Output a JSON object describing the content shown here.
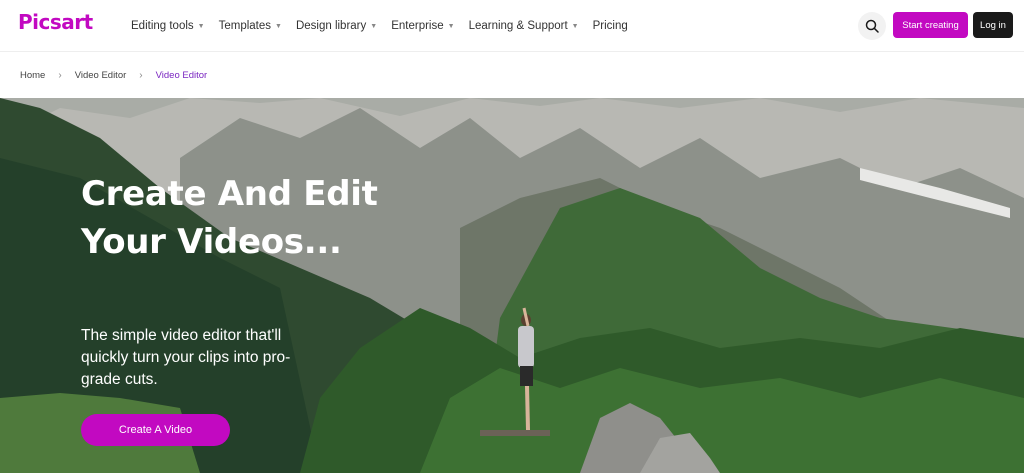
{
  "brand": {
    "logo_text": "Picsart",
    "accent": "#c209c1"
  },
  "nav": {
    "items": [
      {
        "label": "Editing tools",
        "has_dropdown": true
      },
      {
        "label": "Templates",
        "has_dropdown": true
      },
      {
        "label": "Design library",
        "has_dropdown": true
      },
      {
        "label": "Enterprise",
        "has_dropdown": true
      },
      {
        "label": "Learning & Support",
        "has_dropdown": true
      },
      {
        "label": "Pricing",
        "has_dropdown": false
      }
    ],
    "search_icon": "search-icon",
    "start_label": "Start creating",
    "login_label": "Log in"
  },
  "breadcrumb": {
    "items": [
      "Home",
      "Video Editor",
      "Video Editor"
    ]
  },
  "hero": {
    "title": "Create And Edit Your Videos...",
    "subtitle": "The simple video editor that'll quickly turn your clips into pro-grade cuts.",
    "cta_label": "Create A Video"
  }
}
